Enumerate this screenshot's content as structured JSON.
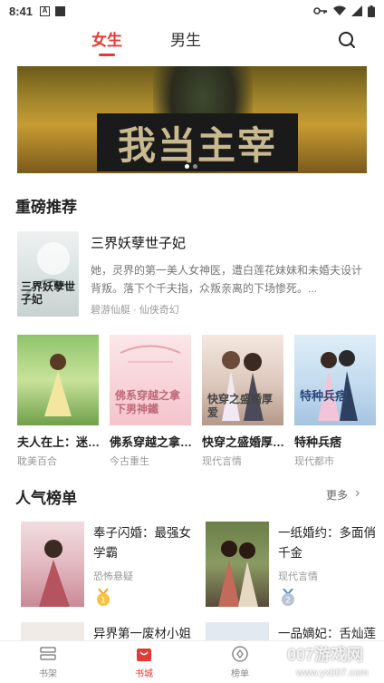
{
  "status_bar": {
    "time": "8:41"
  },
  "top_tabs": {
    "female": "女生",
    "male": "男生"
  },
  "banner": {
    "title": "我当主宰"
  },
  "sections": {
    "recommend": "重磅推荐",
    "popular": "人气榜单",
    "more": "更多"
  },
  "featured": {
    "title": "三界妖孽世子妃",
    "desc": "她，灵界的第一美人女神医，遭白莲花妹妹和未婚夫设计背叛。落下个千夫指，众叛亲离的下场惨死。...",
    "meta": "碧游仙艇 · 仙侠奇幻",
    "cover_text": "三界妖孽世子妃"
  },
  "grid_books": [
    {
      "title": "夫人在上：迷…",
      "tag": "耽美百合",
      "cover_text": ""
    },
    {
      "title": "佛系穿越之拿…",
      "tag": "今古重生",
      "cover_text": "佛系穿越之拿下男神鐵"
    },
    {
      "title": "快穿之盛婚厚…",
      "tag": "现代言情",
      "cover_text": "快穿之盛婚厚爱"
    },
    {
      "title": "特种兵痞",
      "tag": "现代都市",
      "cover_text": "特种兵痞"
    }
  ],
  "rank_books": [
    {
      "title": "奉子闪婚：最强女学霸",
      "tag": "恐怖悬疑",
      "rank": "1"
    },
    {
      "title": "一纸婚约：多面俏千金",
      "tag": "现代言情",
      "rank": "2"
    },
    {
      "title": "异界第一废材小姐",
      "tag": ""
    },
    {
      "title": "一品嫡妃：舌灿莲",
      "tag": ""
    }
  ],
  "bottom_nav": {
    "shelf": "书架",
    "store": "书城",
    "ranking": "榜单"
  },
  "watermark": {
    "line1": "007游戏网",
    "line2": "www.yx007.com"
  },
  "colors": {
    "accent": "#e53935"
  }
}
